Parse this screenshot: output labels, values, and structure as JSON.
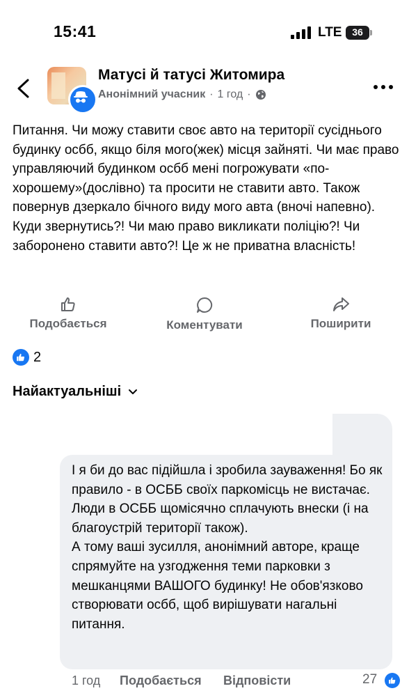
{
  "status_bar": {
    "time": "15:41",
    "network": "LTE",
    "battery": "36"
  },
  "header": {
    "group_name": "Матусі й татусі Житомира",
    "author": "Анонімний учасник",
    "separator": "·",
    "time": "1 год",
    "separator2": "·",
    "icons": [
      "back-arrow-icon",
      "anonymous-icon",
      "globe-icon",
      "more-dots-icon"
    ]
  },
  "post": {
    "text": "Питання. Чи можу ставити своє авто на території сусіднього будинку осбб, якщо біля мого(жек) місця зайняті. Чи має право управляючий будинком осбб мені погрожувати «по-хорошему»(дослівно) та просити не ставити авто. Також повернув дзеркало бічного виду мого авта (вночі напевно). Куди звернутись?! Чи маю право викликати поліцію?! Чи заборонено ставити авто?! Це ж не приватна власність!"
  },
  "actions": {
    "like_label": "Подобається",
    "comment_label": "Коментувати",
    "share_label": "Поширити"
  },
  "reactions": {
    "count": "2"
  },
  "comments": {
    "sort_label": "Найактуальніші",
    "items": [
      {
        "text": "І я би до вас підійшла і зробила зауваження! Бо як правило - в ОСББ своїх паркомісць не вистачає. Люди в ОСББ щомісячно сплачують внески (і на благоустрій території також).\nА тому ваші зусилля, анонімний авторе, краще спрямуйте на узгодження  теми парковки з мешканцями ВАШОГО будинку!  Не обов'язково створювати осбб, щоб вирішувати нагальні питання.",
        "time": "1 год",
        "like_label": "Подобається",
        "reply_label": "Відповісти",
        "reaction_count": "27"
      }
    ]
  },
  "colors": {
    "accent": "#1877f2",
    "secondary_text": "#65676b",
    "bubble": "#eef0f3"
  }
}
